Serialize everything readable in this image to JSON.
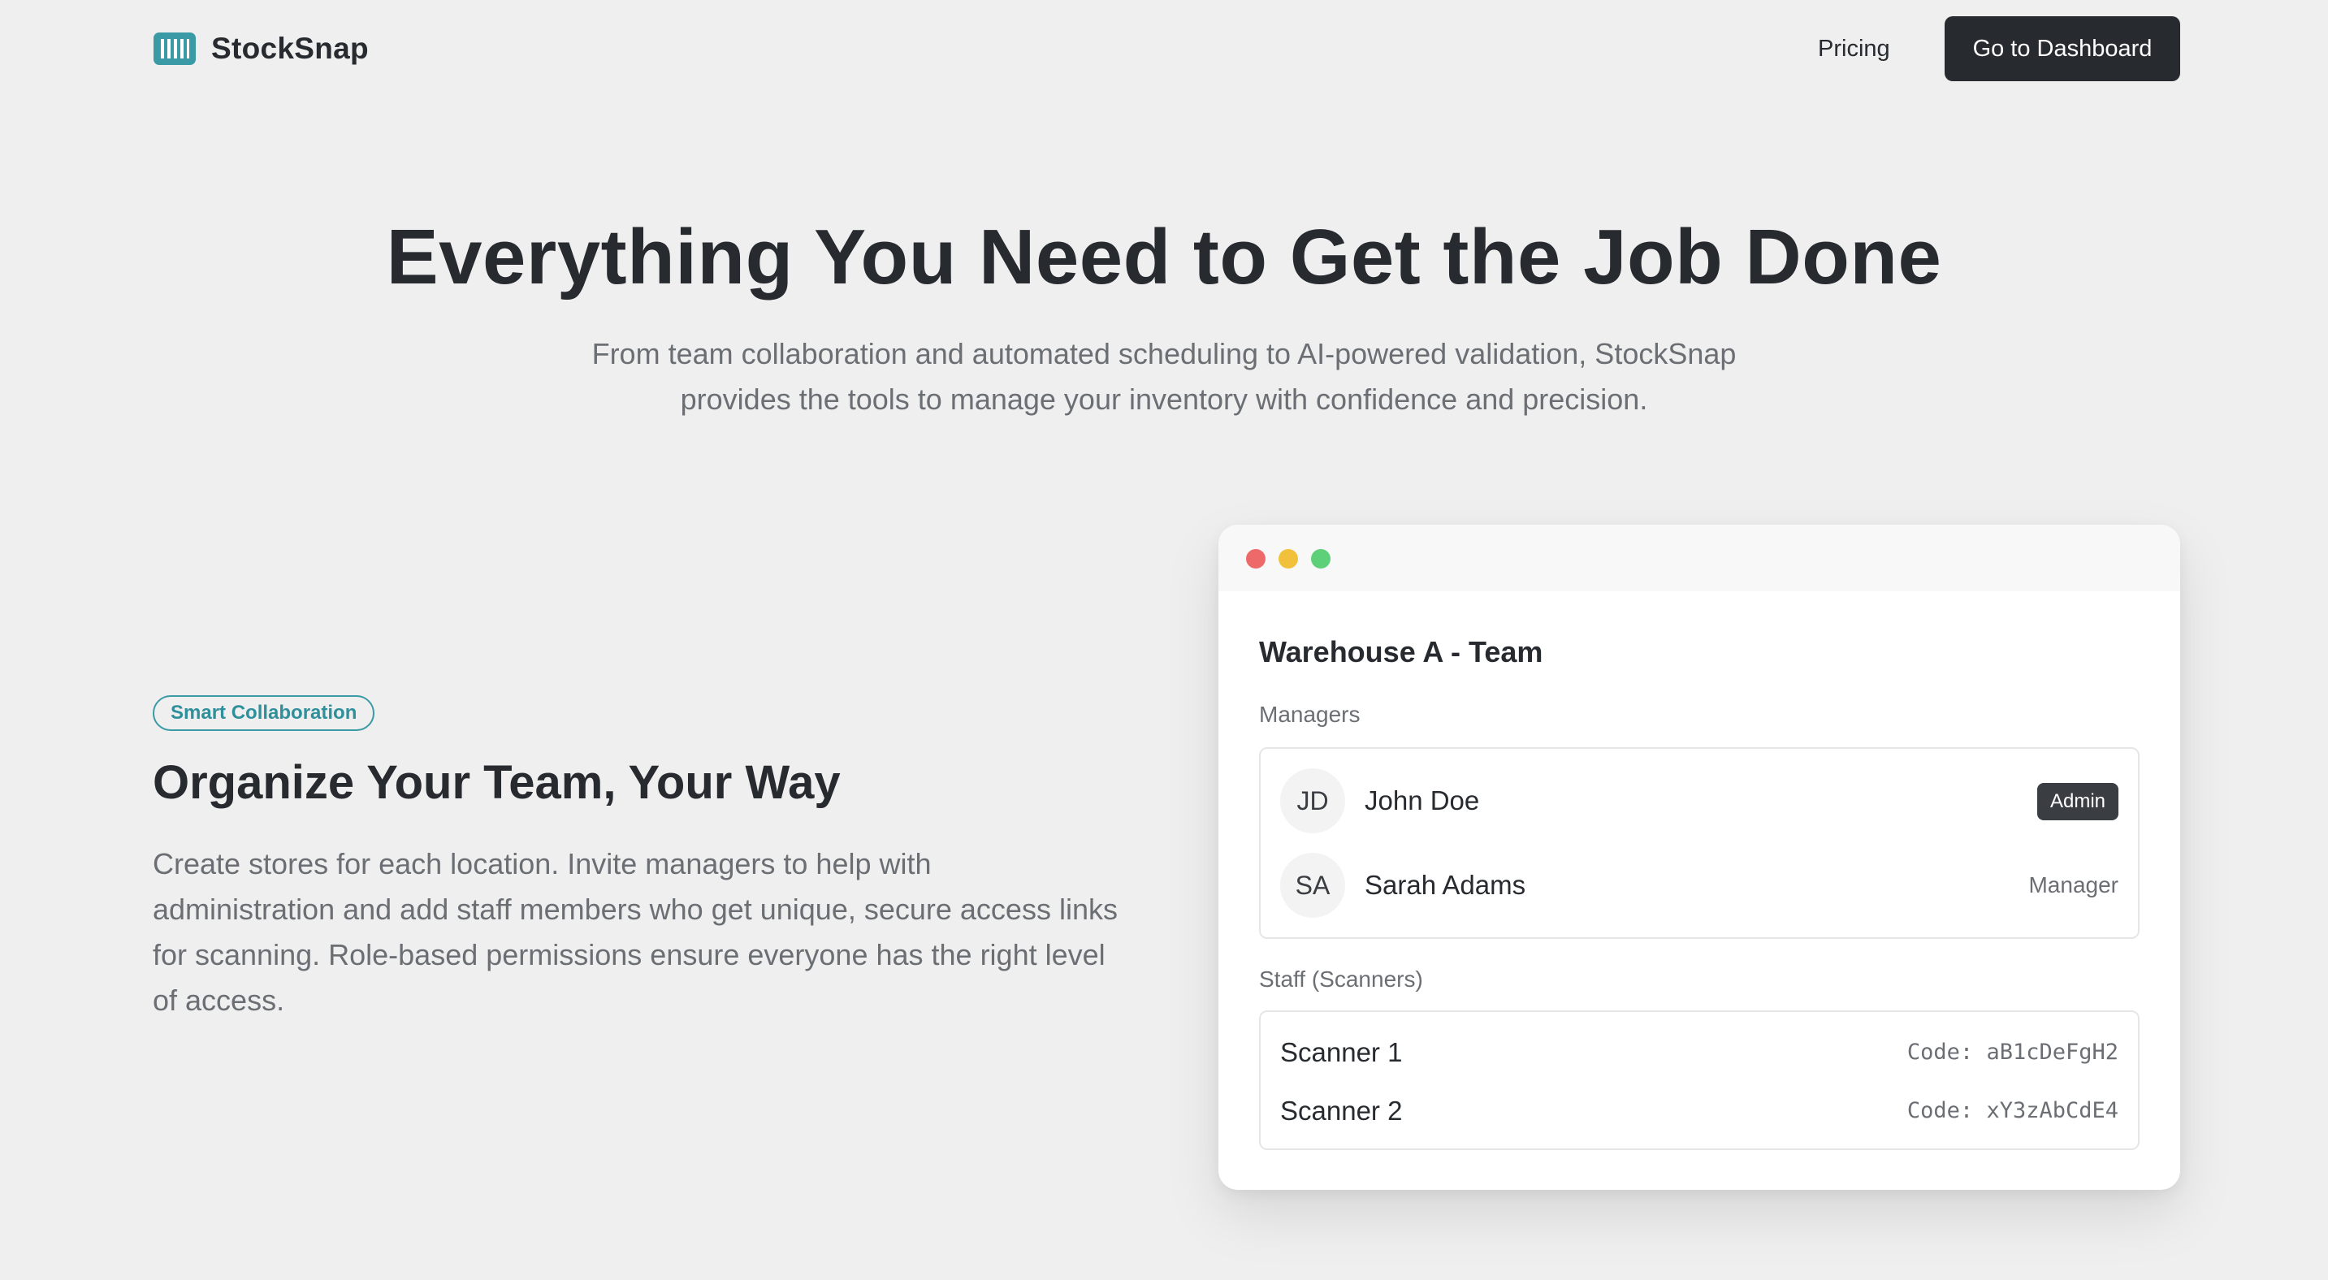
{
  "header": {
    "brand_name": "StockSnap",
    "brand_icon": "barcode-icon",
    "nav": {
      "pricing_label": "Pricing",
      "dashboard_label": "Go to Dashboard"
    }
  },
  "hero": {
    "title": "Everything You Need to Get the Job Done",
    "subtitle_line1": "From team collaboration and automated scheduling to AI-powered validation, StockSnap",
    "subtitle_line2": "provides the tools to manage your inventory with confidence and precision."
  },
  "feature": {
    "badge": "Smart Collaboration",
    "title": "Organize Your Team, Your Way",
    "description": "Create stores for each location. Invite managers to help with administration and add staff members who get unique, secure access links for scanning. Role-based permissions ensure everyone has the right level of access."
  },
  "mock_window": {
    "title": "Warehouse A - Team",
    "managers_label": "Managers",
    "managers": [
      {
        "initials": "JD",
        "name": "John Doe",
        "role": "Admin"
      },
      {
        "initials": "SA",
        "name": "Sarah Adams",
        "role": "Manager"
      }
    ],
    "staff_label": "Staff (Scanners)",
    "staff": [
      {
        "name": "Scanner 1",
        "code": "Code: aB1cDeFgH2"
      },
      {
        "name": "Scanner 2",
        "code": "Code: xY3zAbCdE4"
      }
    ]
  },
  "colors": {
    "background": "#efefef",
    "text_primary": "#272a2f",
    "text_secondary": "#6b6e73",
    "accent_teal": "#3a9aa6",
    "button_dark": "#272a2f",
    "dot_red": "#ee6a6a",
    "dot_yellow": "#f2c13c",
    "dot_green": "#5fd07a"
  }
}
